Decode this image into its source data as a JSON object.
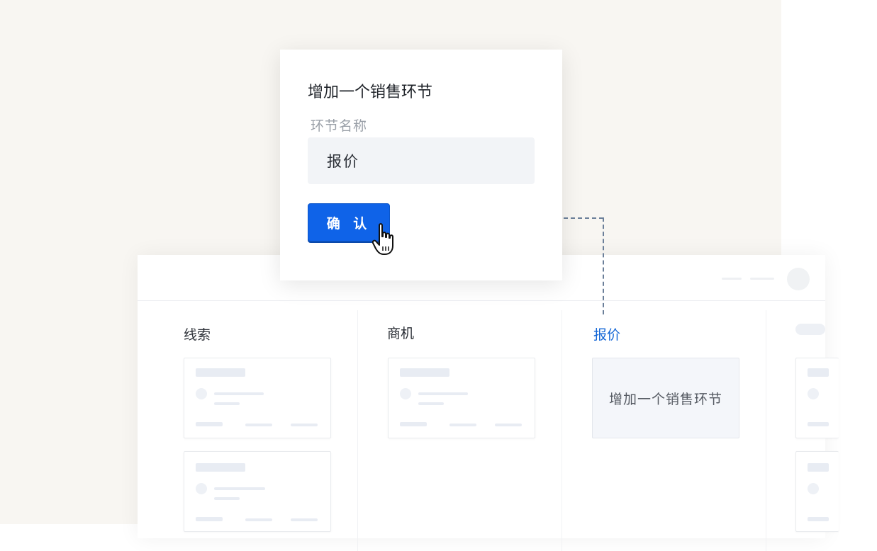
{
  "dialog": {
    "title": "增加一个销售环节",
    "field_label": "环节名称",
    "field_value": "报价",
    "confirm_label": "确 认"
  },
  "board": {
    "columns": [
      {
        "title": "线索"
      },
      {
        "title": "商机"
      },
      {
        "title": "报价"
      }
    ],
    "add_stage_label": "增加一个销售环节"
  },
  "colors": {
    "primary": "#0f63e8",
    "active_column_title": "#1366d6",
    "background": "#f8f6f2"
  },
  "icons": [
    "hand-pointer-cursor-icon",
    "avatar"
  ]
}
